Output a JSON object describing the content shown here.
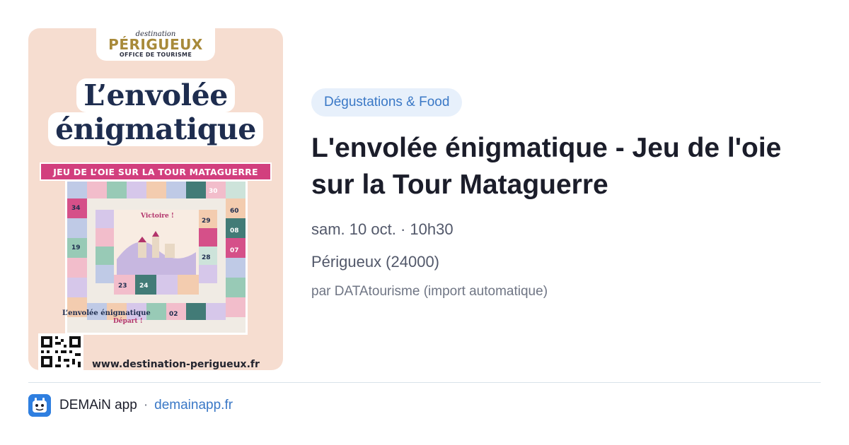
{
  "poster": {
    "logo_top": "destination",
    "logo_main": "PÉRIGUEUX",
    "logo_sub": "OFFICE DE TOURISME",
    "title_line1": "L’envolée",
    "title_line2": "énigmatique",
    "banner": "JEU DE L’OIE SUR LA TOUR MATAGUERRE",
    "victory": "Victoire !",
    "board_name": "L’envolée énigmatique",
    "depart": "Départ !",
    "url": "www.destination-perigueux.fr"
  },
  "event": {
    "category": "Dégustations & Food",
    "title": "L'envolée énigmatique - Jeu de l'oie sur la Tour Mataguerre",
    "date": "sam. 10 oct. · 10h30",
    "location": "Périgueux (24000)",
    "author": "par DATAtourisme (import automatique)"
  },
  "footer": {
    "app_icon": "demain-app-icon",
    "app_name": "DEMAiN app",
    "separator": "·",
    "domain": "demainapp.fr"
  },
  "colors": {
    "accent": "#3a78c6",
    "category_bg": "#e7f0fb",
    "poster_bg": "#f6ddd0",
    "poster_title": "#1e2d4f",
    "poster_banner": "#d23f7e"
  }
}
